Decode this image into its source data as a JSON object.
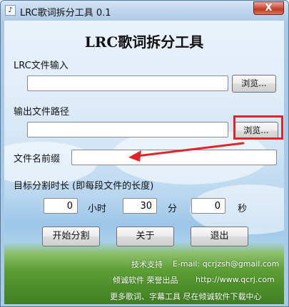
{
  "window": {
    "title": "LRC歌词拆分工具 0.1",
    "app_icon": "music-note-icon",
    "close_label": "X"
  },
  "main": {
    "heading": "LRC歌词拆分工具",
    "lrc_input": {
      "label": "LRC文件输入",
      "value": "",
      "browse_label": "浏览..."
    },
    "output_path": {
      "label": "输出文件路径",
      "value": "",
      "browse_label": "浏览..."
    },
    "prefix": {
      "label": "文件名前缀",
      "value": ""
    },
    "duration": {
      "label": "目标分割时长   (即每段文件的长度)",
      "hours": "0",
      "hours_unit": "小时",
      "minutes": "30",
      "minutes_unit": "分",
      "seconds": "0",
      "seconds_unit": "秒"
    },
    "buttons": {
      "start": "开始分割",
      "about": "关于",
      "exit": "退出"
    }
  },
  "footer": {
    "support_label": "技术支持",
    "email": "E-mail: qcrjzsh@gmail.com",
    "brand": "倾诚软件 荣誉出品",
    "url": "http://www.qcrj.com",
    "more": "更多歌词、字幕工具 尽在倾诚软件下载中心"
  },
  "colors": {
    "highlight": "#e0242a",
    "arrow": "#e0242a"
  }
}
